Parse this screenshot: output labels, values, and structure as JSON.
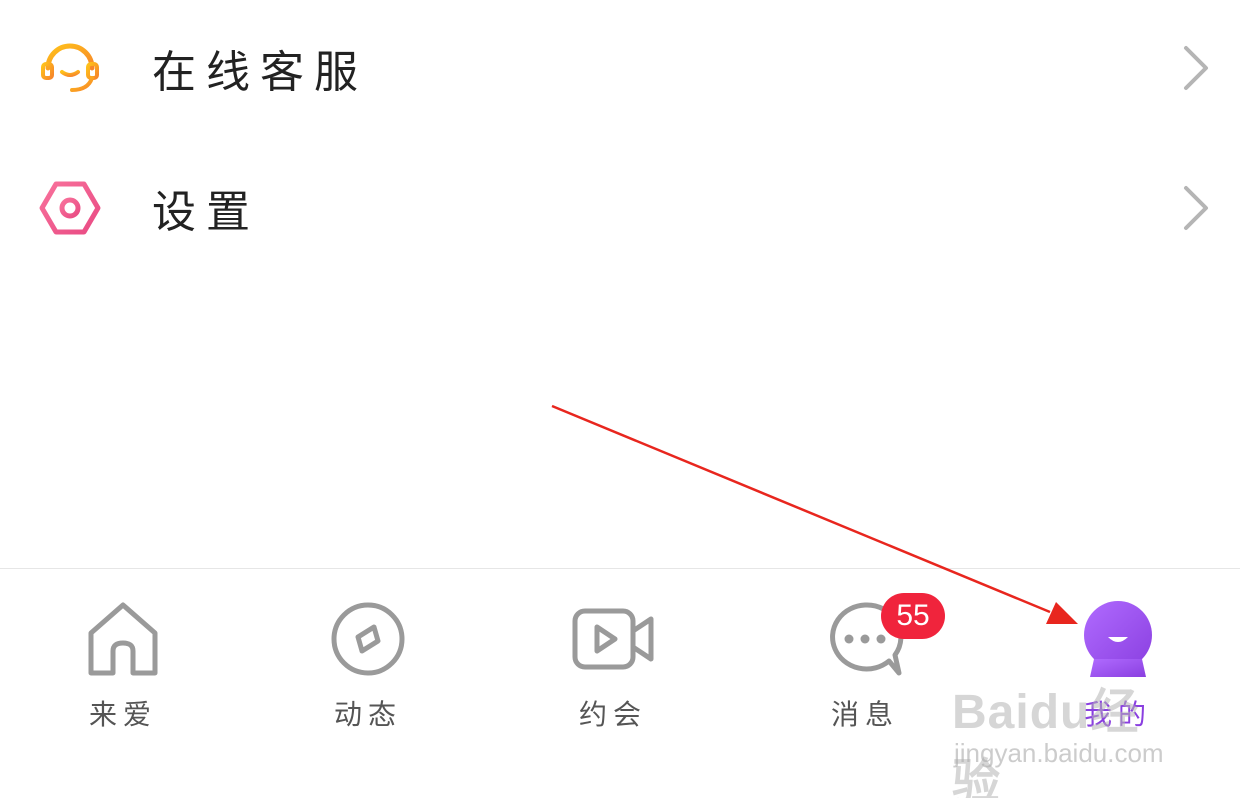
{
  "menu": {
    "items": [
      {
        "label": "在线客服",
        "icon": "headset-icon",
        "color": "#f5a623"
      },
      {
        "label": "设置",
        "icon": "settings-hexagon-icon",
        "color": "#ef5a8a"
      }
    ]
  },
  "tabbar": {
    "tabs": [
      {
        "label": "来爱",
        "icon": "home-icon",
        "active": false
      },
      {
        "label": "动态",
        "icon": "compass-icon",
        "active": false
      },
      {
        "label": "约会",
        "icon": "video-camera-icon",
        "active": false
      },
      {
        "label": "消息",
        "icon": "chat-bubble-icon",
        "active": false,
        "badge": "55"
      },
      {
        "label": "我的",
        "icon": "mine-avatar-icon",
        "active": true
      }
    ]
  },
  "colors": {
    "inactive_icon": "#9a9a9a",
    "active_accent": "#9b4dff",
    "badge": "#f0243c",
    "annotation_arrow": "#e8261e"
  },
  "watermark": {
    "brand": "Baidu经验",
    "url": "jingyan.baidu.com"
  }
}
